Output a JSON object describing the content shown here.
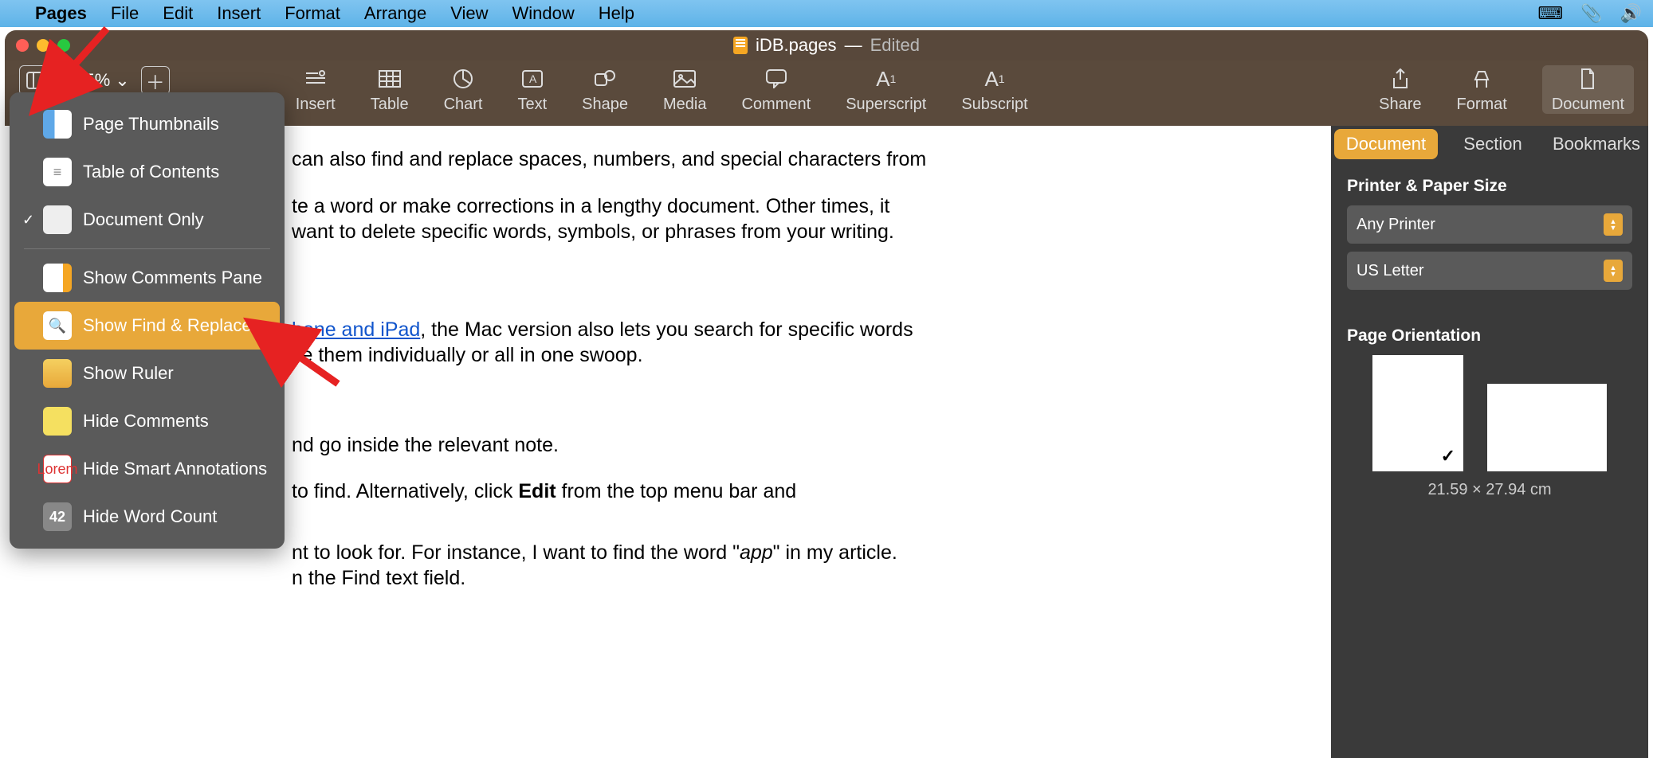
{
  "menubar": {
    "app": "Pages",
    "items": [
      "File",
      "Edit",
      "Insert",
      "Format",
      "Arrange",
      "View",
      "Window",
      "Help"
    ]
  },
  "window": {
    "filename": "iDB.pages",
    "status": "Edited",
    "zoom": "125%"
  },
  "toolbar": {
    "insert": "Insert",
    "table": "Table",
    "chart": "Chart",
    "text": "Text",
    "shape": "Shape",
    "media": "Media",
    "comment": "Comment",
    "superscript": "Superscript",
    "subscript": "Subscript",
    "share": "Share",
    "format": "Format",
    "document": "Document"
  },
  "dropdown": {
    "page_thumbnails": "Page Thumbnails",
    "toc": "Table of Contents",
    "doc_only": "Document Only",
    "comments_pane": "Show Comments Pane",
    "find_replace": "Show Find & Replace",
    "ruler": "Show Ruler",
    "hide_comments": "Hide Comments",
    "hide_smart": "Hide Smart Annotations",
    "hide_wc": "Hide Word Count"
  },
  "doc": {
    "p1": "can also find and replace spaces, numbers, and special characters from",
    "p2a": "te a word or make corrections in a lengthy document. Other times, it",
    "p2b": "want to delete specific words, symbols, or phrases from your writing.",
    "p3link": "hone and iPad",
    "p3a": ", the Mac version also lets you search for specific words",
    "p3b": "ce them individually or all in one swoop.",
    "p4": "nd go inside the relevant note.",
    "p5a": "to find. Alternatively, click ",
    "p5b": "Edit",
    "p5c": " from the top menu bar and",
    "p6a": "nt to look for. For instance, I want to find the word \"",
    "p6b": "app",
    "p6c": "\" in my article.",
    "p7": "n the Find text field."
  },
  "inspector": {
    "tabs": {
      "document": "Document",
      "section": "Section",
      "bookmarks": "Bookmarks"
    },
    "printer_header": "Printer & Paper Size",
    "printer": "Any Printer",
    "paper": "US Letter",
    "orientation_header": "Page Orientation",
    "dimensions": "21.59 × 27.94 cm"
  }
}
